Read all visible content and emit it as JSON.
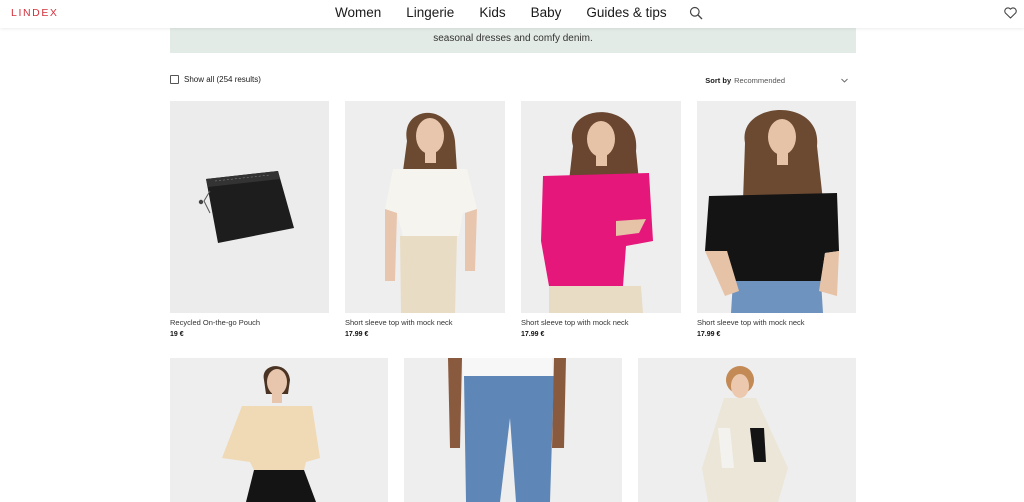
{
  "brand": {
    "logo_text": "LINDEX",
    "logo_color": "#d3323d"
  },
  "nav": {
    "items": [
      "Women",
      "Lingerie",
      "Kids",
      "Baby",
      "Guides & tips"
    ]
  },
  "icons": {
    "search": "search-icon",
    "wishlist": "heart-icon",
    "checkbox": "checkbox-icon",
    "sort": "chevron-down-icon"
  },
  "promo": {
    "text": "seasonal dresses and comfy denim.",
    "bg": "#e3ebe6"
  },
  "filters": {
    "show_all_label": "Show all (254 results)",
    "sort_label": "Sort by",
    "sort_value": "Recommended"
  },
  "products": [
    {
      "name": "Recycled On-the-go Pouch",
      "price": "19 €"
    },
    {
      "name": "Short sleeve top with mock neck",
      "price": "17.99 €",
      "top_color": "#f6f4ef"
    },
    {
      "name": "Short sleeve top with mock neck",
      "price": "17.99 €",
      "top_color": "#e6177a"
    },
    {
      "name": "Short sleeve top with mock neck",
      "price": "17.99 €",
      "top_color": "#141414"
    }
  ]
}
